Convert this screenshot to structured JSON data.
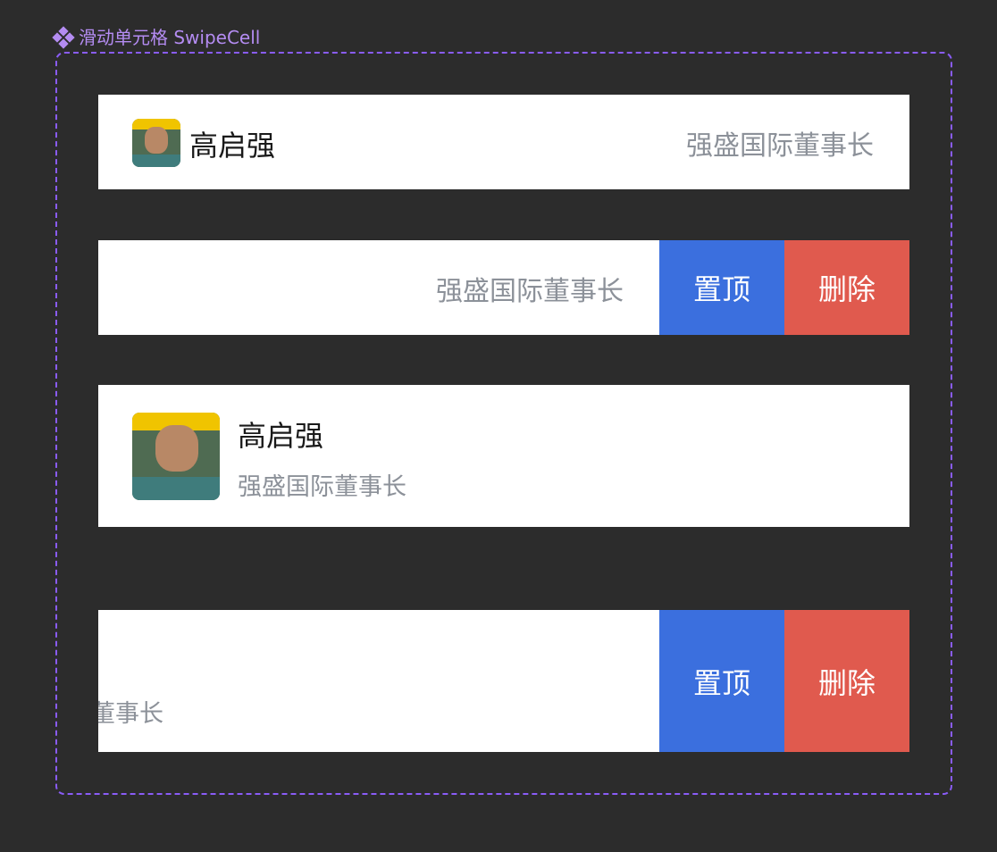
{
  "frame": {
    "label": "滑动单元格 SwipeCell"
  },
  "cells": [
    {
      "name": "高启强",
      "desc": "强盛国际董事长"
    },
    {
      "desc": "强盛国际董事长",
      "actions": {
        "pin": "置顶",
        "delete": "删除"
      }
    },
    {
      "name": "高启强",
      "desc": "强盛国际董事长"
    },
    {
      "desc": "董事长",
      "actions": {
        "pin": "置顶",
        "delete": "删除"
      }
    }
  ],
  "colors": {
    "pin": "#3b6fde",
    "delete": "#e05a4e",
    "frame": "#8a5cf6"
  },
  "icons": [
    "component-diamond-icon",
    "avatar-image"
  ]
}
